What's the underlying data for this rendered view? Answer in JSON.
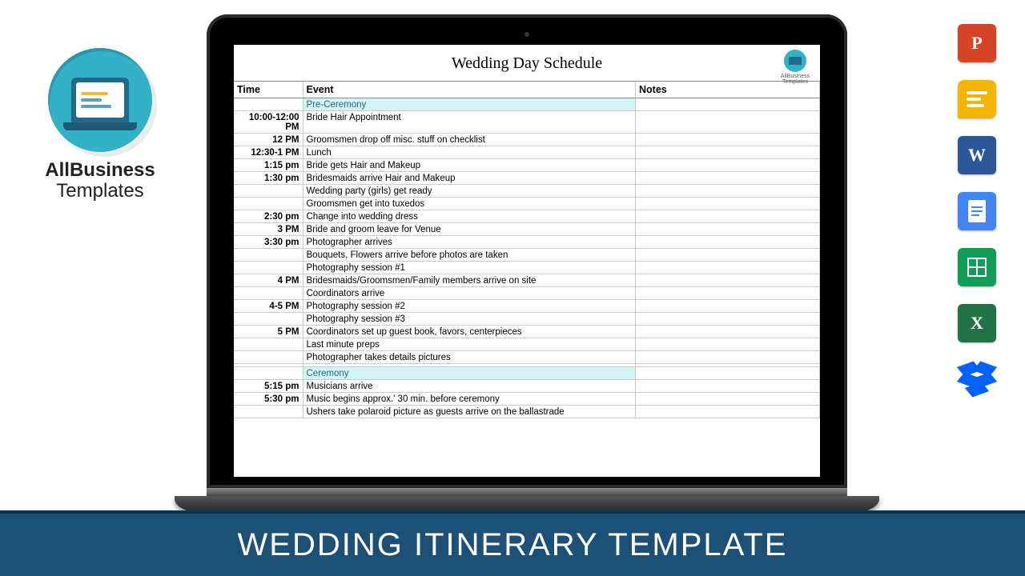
{
  "brand": {
    "line1": "AllBusiness",
    "line2": "Templates"
  },
  "document": {
    "title": "Wedding Day Schedule",
    "doc_logo_label": "AllBusiness Templates",
    "columns": {
      "time": "Time",
      "event": "Event",
      "notes": "Notes"
    },
    "rows": [
      {
        "time": "",
        "event": "Pre-Ceremony",
        "notes": "",
        "section": true
      },
      {
        "time": "10:00-12:00 PM",
        "event": "Bride Hair Appointment",
        "notes": ""
      },
      {
        "time": "12 PM",
        "event": "Groomsmen drop off misc. stuff on checklist",
        "notes": ""
      },
      {
        "time": "12:30-1 PM",
        "event": "Lunch",
        "notes": ""
      },
      {
        "time": "1:15 pm",
        "event": "Bride gets Hair and Makeup",
        "notes": ""
      },
      {
        "time": "1:30 pm",
        "event": "Bridesmaids arrive Hair and Makeup",
        "notes": ""
      },
      {
        "time": "",
        "event": "Wedding party (girls) get ready",
        "notes": ""
      },
      {
        "time": "",
        "event": "Groomsmen get into tuxedos",
        "notes": ""
      },
      {
        "time": "2:30 pm",
        "event": "Change into wedding dress",
        "notes": ""
      },
      {
        "time": "3 PM",
        "event": "Bride and groom leave for Venue",
        "notes": ""
      },
      {
        "time": "3:30 pm",
        "event": "Photographer arrives",
        "notes": ""
      },
      {
        "time": "",
        "event": "Bouquets, Flowers arrive before photos are taken",
        "notes": ""
      },
      {
        "time": "",
        "event": "Photography session #1",
        "notes": ""
      },
      {
        "time": "4 PM",
        "event": "Bridesmaids/Groomsmen/Family members arrive on site",
        "notes": ""
      },
      {
        "time": "",
        "event": "Coordinators arrive",
        "notes": ""
      },
      {
        "time": "4-5 PM",
        "event": "Photography session #2",
        "notes": ""
      },
      {
        "time": "",
        "event": "Photography session #3",
        "notes": ""
      },
      {
        "time": "5 PM",
        "event": "Coordinators set up guest book, favors, centerpieces",
        "notes": ""
      },
      {
        "time": "",
        "event": "Last minute preps",
        "notes": ""
      },
      {
        "time": "",
        "event": "Photographer takes details pictures",
        "notes": ""
      },
      {
        "time": "",
        "event": "",
        "notes": ""
      },
      {
        "time": "",
        "event": "Ceremony",
        "notes": "",
        "section": true
      },
      {
        "time": "5:15 pm",
        "event": "Musicians arrive",
        "notes": ""
      },
      {
        "time": "5:30 pm",
        "event": "Music begins approx.' 30 min. before ceremony",
        "notes": ""
      },
      {
        "time": "",
        "event": "Ushers take polaroid picture as guests arrive on the ballastrade",
        "notes": ""
      }
    ]
  },
  "apps": {
    "powerpoint": "P",
    "slides": "",
    "word": "W",
    "docs": "",
    "sheets": "",
    "excel": "X",
    "dropbox": ""
  },
  "banner": "WEDDING ITINERARY TEMPLATE"
}
